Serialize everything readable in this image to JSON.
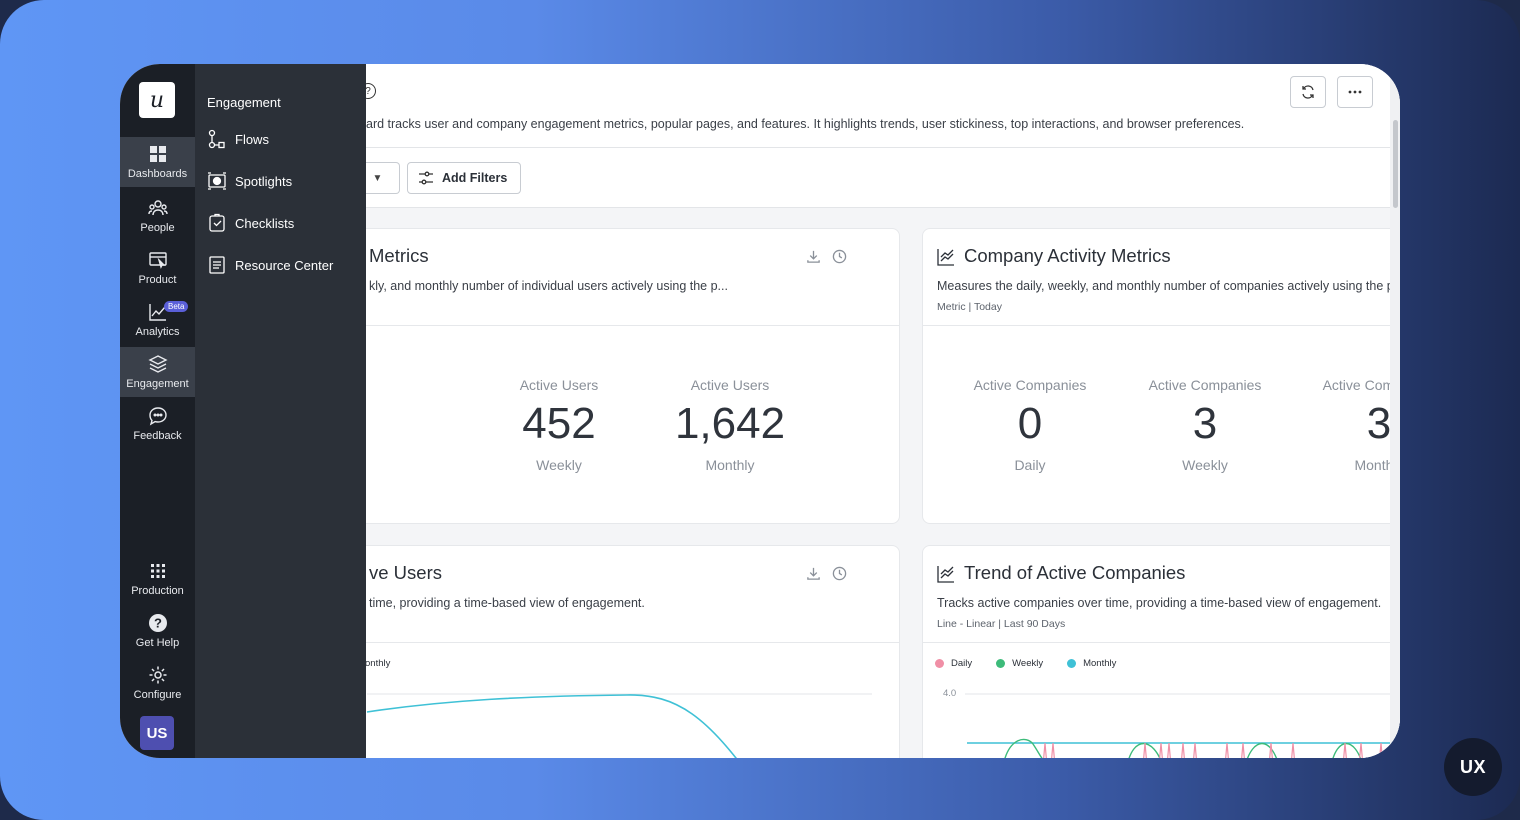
{
  "rail": {
    "logo": "u",
    "items": [
      {
        "label": "Dashboards"
      },
      {
        "label": "People"
      },
      {
        "label": "Product"
      },
      {
        "label": "Analytics",
        "badge": "Beta"
      },
      {
        "label": "Engagement"
      },
      {
        "label": "Feedback"
      }
    ],
    "bottom": [
      {
        "label": "Production"
      },
      {
        "label": "Get Help"
      },
      {
        "label": "Configure"
      }
    ],
    "avatar": "US"
  },
  "submenu": {
    "title": "Engagement",
    "items": [
      {
        "label": "Flows",
        "icon": "flows-icon"
      },
      {
        "label": "Spotlights",
        "icon": "spotlight-icon"
      },
      {
        "label": "Checklists",
        "icon": "checklist-icon"
      },
      {
        "label": "Resource Center",
        "icon": "resource-center-icon"
      }
    ]
  },
  "header": {
    "description": "ard tracks user and company engagement metrics, popular pages, and features. It highlights trends, user stickiness, top interactions, and browser preferences."
  },
  "filters": {
    "add_filters_label": "Add Filters"
  },
  "cards": {
    "user_metrics": {
      "title": "Metrics",
      "description": "kly, and monthly number of individual users actively using the p...",
      "metrics": [
        {
          "label": "Active Users",
          "value": "452",
          "period": "Weekly"
        },
        {
          "label": "Active Users",
          "value": "1,642",
          "period": "Monthly"
        }
      ]
    },
    "company_metrics": {
      "title": "Company Activity Metrics",
      "description": "Measures the daily, weekly, and monthly number of companies actively using the produ...",
      "meta": "Metric | Today",
      "metrics": [
        {
          "label": "Active Companies",
          "value": "0",
          "period": "Daily"
        },
        {
          "label": "Active Companies",
          "value": "3",
          "period": "Weekly"
        },
        {
          "label": "Active Companies",
          "value": "3",
          "period": "Monthly"
        }
      ]
    },
    "trend_users": {
      "title": "ve Users",
      "description": "time, providing a time-based view of engagement.",
      "legend_fragment": "onthly"
    },
    "trend_companies": {
      "title": "Trend of Active Companies",
      "description": "Tracks active companies over time, providing a time-based view of engagement.",
      "meta": "Line - Linear | Last 90 Days",
      "legend": [
        {
          "label": "Daily",
          "color": "#f08fa6"
        },
        {
          "label": "Weekly",
          "color": "#3dbb7a"
        },
        {
          "label": "Monthly",
          "color": "#3fc1d6"
        }
      ],
      "y_tick": "4.0"
    }
  },
  "badge": "UX"
}
